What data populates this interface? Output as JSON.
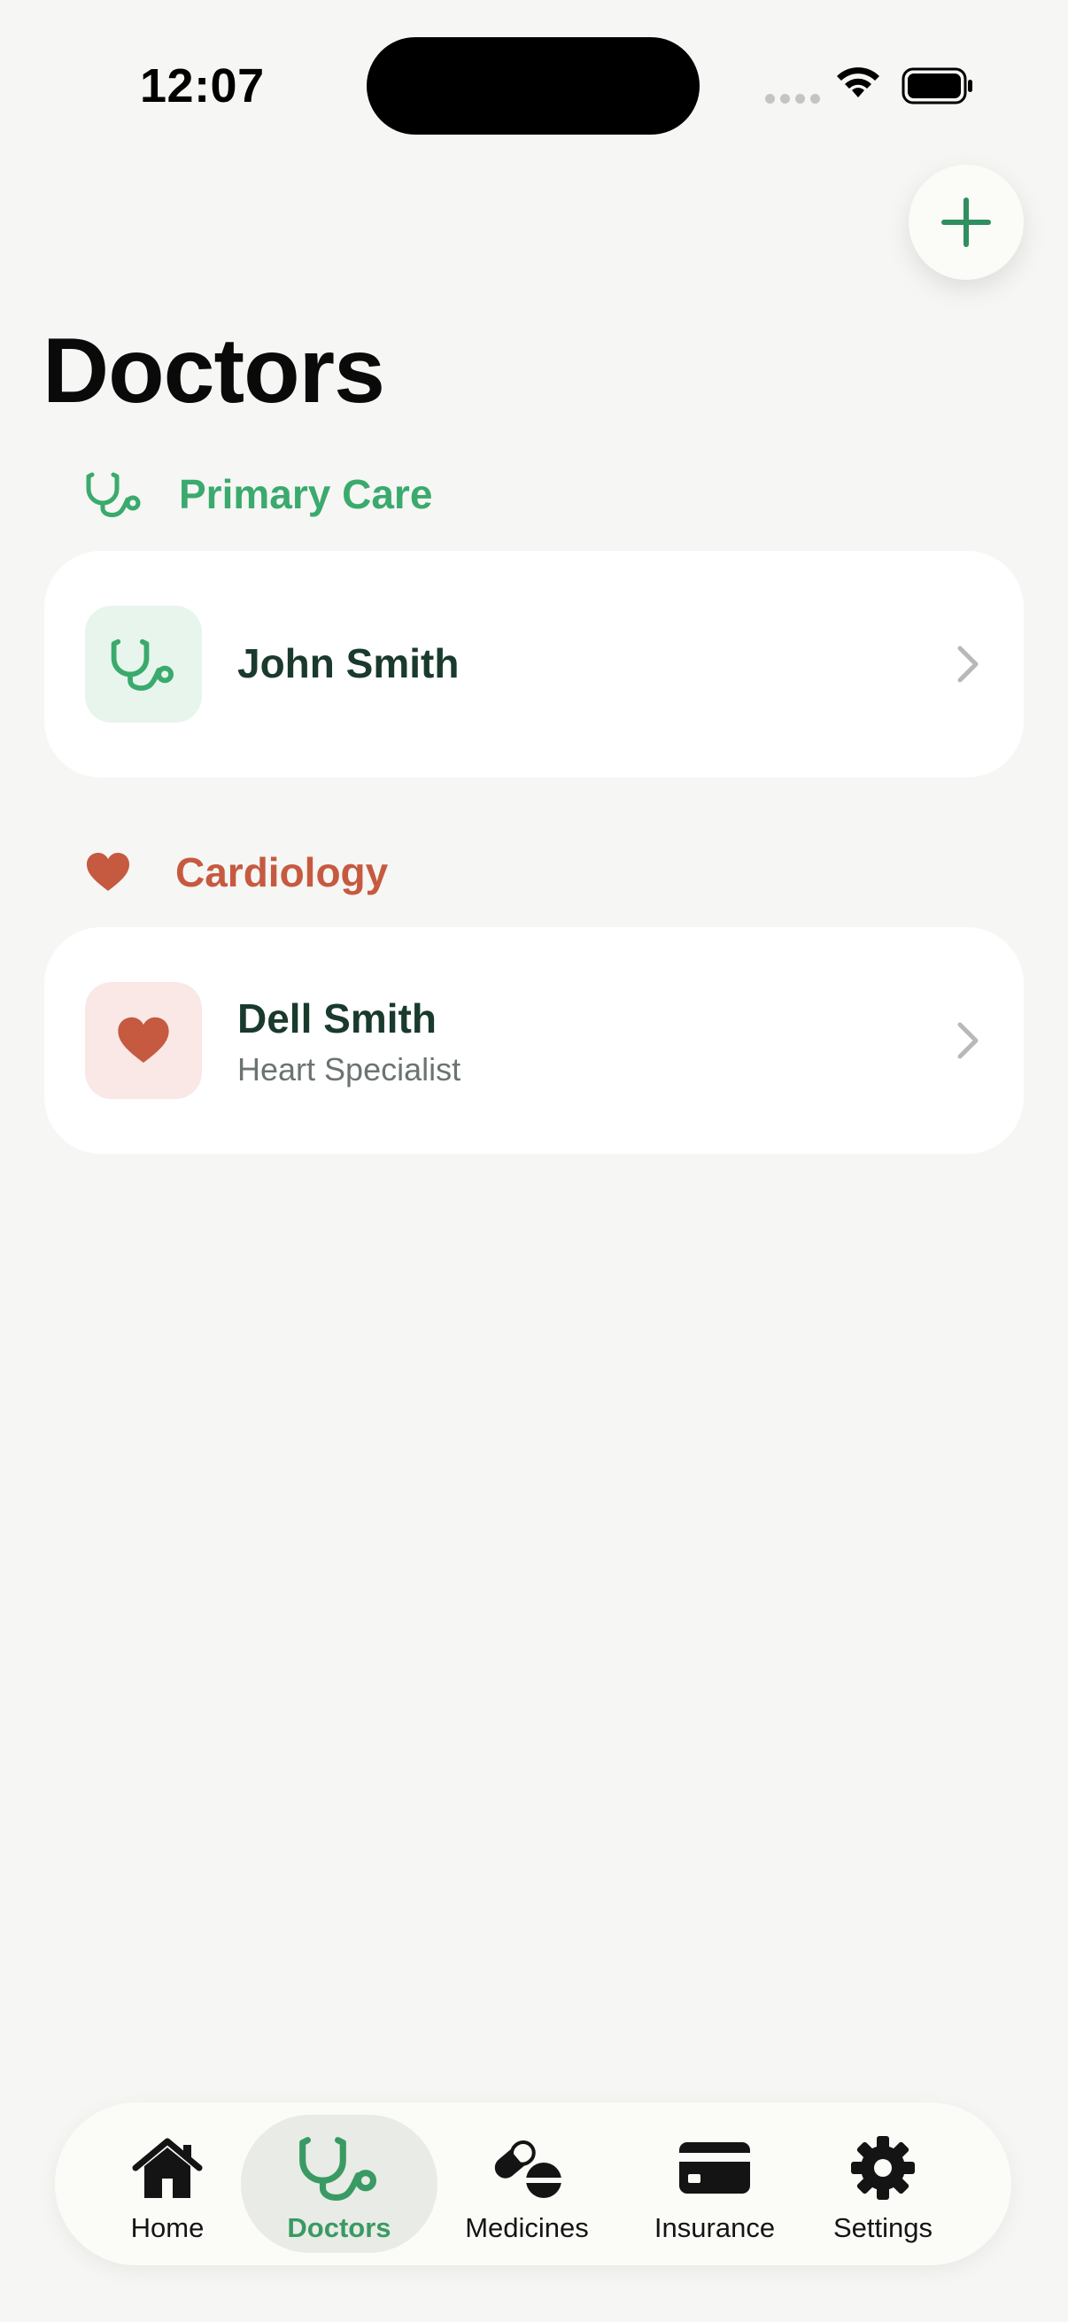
{
  "status_bar": {
    "time": "12:07"
  },
  "page": {
    "title": "Doctors"
  },
  "sections": [
    {
      "label": "Primary Care",
      "icon": "stethoscope-icon",
      "color": "#3aaa6d",
      "doctors": [
        {
          "name": "John Smith",
          "specialty": ""
        }
      ]
    },
    {
      "label": "Cardiology",
      "icon": "heart-icon",
      "color": "#c65a40",
      "doctors": [
        {
          "name": "Dell Smith",
          "specialty": "Heart Specialist"
        }
      ]
    }
  ],
  "tabbar": {
    "items": [
      {
        "label": "Home",
        "icon": "house-icon"
      },
      {
        "label": "Doctors",
        "icon": "stethoscope-icon",
        "active": true
      },
      {
        "label": "Medicines",
        "icon": "pills-icon"
      },
      {
        "label": "Insurance",
        "icon": "credit-card-icon"
      },
      {
        "label": "Settings",
        "icon": "gear-icon"
      }
    ]
  },
  "colors": {
    "accent_green": "#3aaa6d",
    "accent_red": "#c65a40",
    "background": "#f6f6f4"
  }
}
